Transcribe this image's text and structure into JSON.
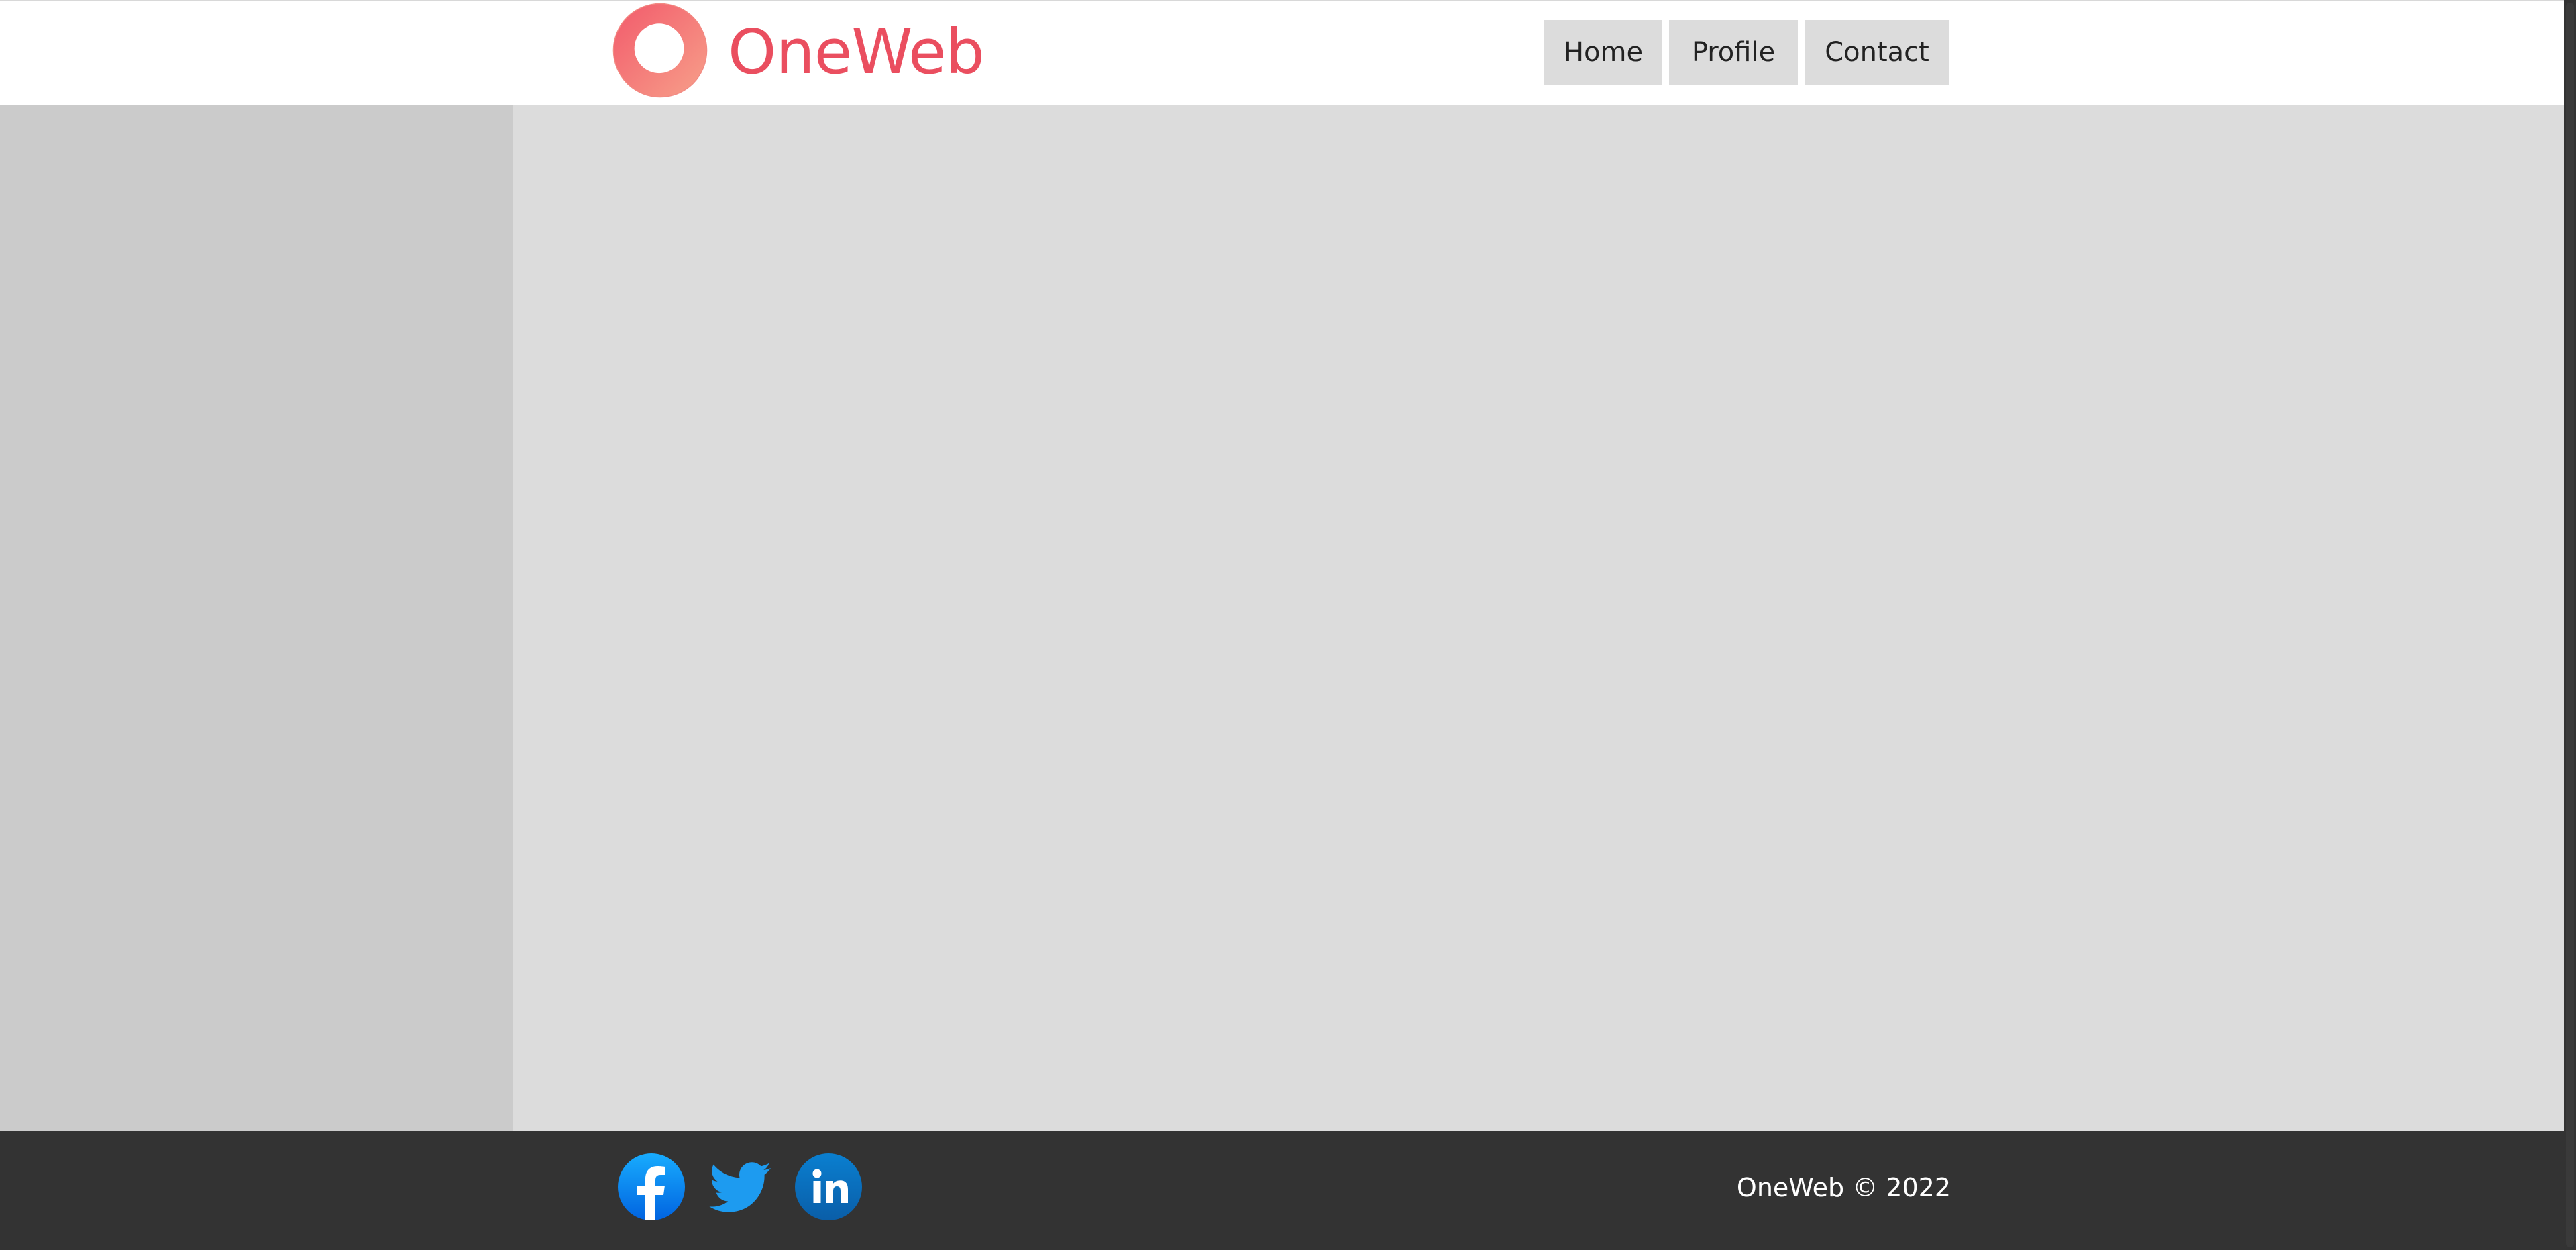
{
  "brand": {
    "name": "OneWeb",
    "color": "#ea4e5f",
    "logo_icon": "ring-logo-icon"
  },
  "nav": {
    "items": [
      {
        "label": "Home"
      },
      {
        "label": "Profile"
      },
      {
        "label": "Contact"
      }
    ]
  },
  "footer": {
    "social": [
      {
        "icon": "facebook-icon",
        "color": "#1877f2"
      },
      {
        "icon": "twitter-icon",
        "color": "#1d9bf0"
      },
      {
        "icon": "linkedin-icon",
        "color": "#0a66c2"
      }
    ],
    "copyright": "OneWeb © 2022"
  },
  "colors": {
    "sidebar": "#cbcbcb",
    "main": "#dcdcdc",
    "footer": "#333333",
    "nav_button": "#dcdcdc"
  }
}
